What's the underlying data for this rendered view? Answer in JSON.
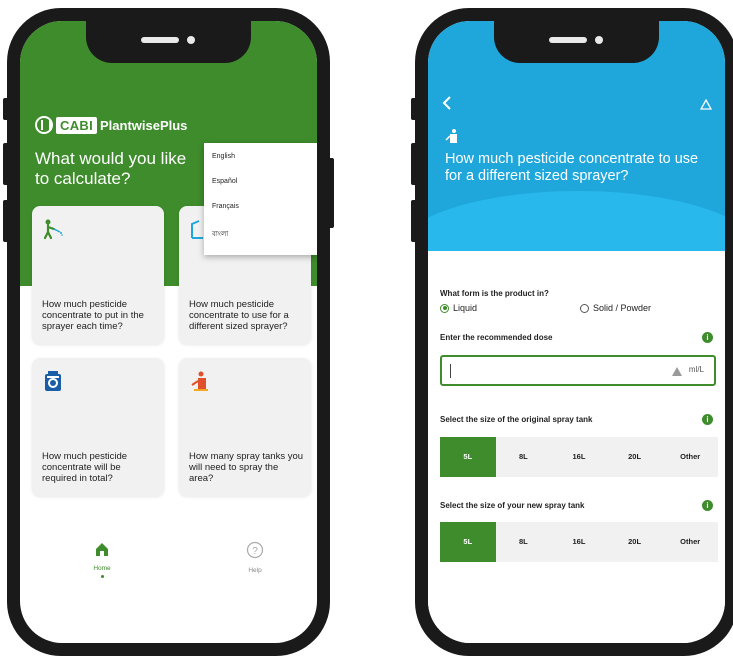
{
  "home": {
    "logo_cabi": "CABI",
    "logo_product": "PlantwisePlus",
    "title": "What would you like to calculate?",
    "languages": [
      "English",
      "Español",
      "Français",
      "বাংলা"
    ],
    "cards": [
      {
        "icon": "sprayer-person-icon",
        "text": "How much pesticide concentrate to put in the sprayer each time?"
      },
      {
        "icon": "sprayer-resize-icon",
        "text": "How much pesticide concentrate to use for a different sized sprayer?"
      },
      {
        "icon": "pesticide-container-icon",
        "text": "How much pesticide concentrate will be required in total?"
      },
      {
        "icon": "spray-tank-icon",
        "text": "How many spray tanks you will need to spray the area?"
      }
    ],
    "nav": {
      "home_label": "Home",
      "help_label": "Help"
    }
  },
  "calc": {
    "back_icon": "back-chevron-icon",
    "warning_icon": "warning-icon",
    "title": "How much pesticide concentrate to use for a different sized sprayer?",
    "form_question": "What form is the product in?",
    "form_options": {
      "liquid": "Liquid",
      "solid": "Solid / Powder",
      "selected": "Liquid"
    },
    "dose_label": "Enter the recommended dose",
    "dose_value": "",
    "dose_unit": "ml/L",
    "original_tank_label": "Select the size of the original spray tank",
    "new_tank_label": "Select the size of your new spray tank",
    "tank_sizes": [
      "5L",
      "8L",
      "16L",
      "20L",
      "Other"
    ],
    "original_selected": "5L",
    "new_selected": "5L",
    "info_icon_glyph": "i"
  },
  "colors": {
    "green": "#3e8c2c",
    "blue": "#1fa7dc",
    "orange": "#e0502a"
  }
}
